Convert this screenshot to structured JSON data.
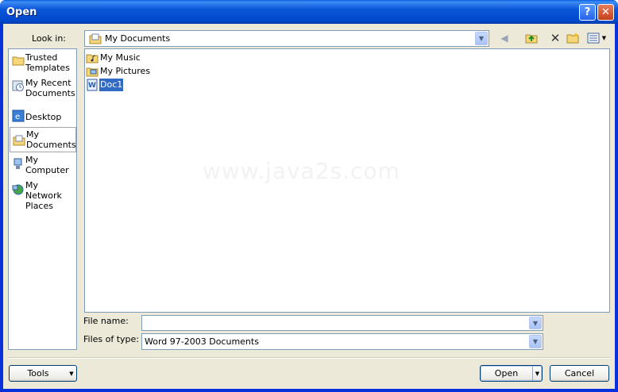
{
  "window": {
    "title": "Open",
    "help_label": "?",
    "close_label": "✕"
  },
  "look_in": {
    "label": "Look in:",
    "value": "My Documents",
    "toolbar": [
      "back-icon",
      "up-folder-icon",
      "delete-icon",
      "new-folder-icon",
      "views-icon"
    ]
  },
  "places": [
    {
      "label": "Trusted Templates",
      "icon": "folder-icon"
    },
    {
      "label": "My Recent Documents",
      "icon": "recent-documents-icon"
    },
    {
      "label": "Desktop",
      "icon": "desktop-icon"
    },
    {
      "label": "My Documents",
      "icon": "my-documents-icon",
      "selected": true
    },
    {
      "label": "My Computer",
      "icon": "my-computer-icon"
    },
    {
      "label": "My Network Places",
      "icon": "network-places-icon"
    }
  ],
  "files": [
    {
      "name": "My Music",
      "icon": "music-folder-icon"
    },
    {
      "name": "My Pictures",
      "icon": "pictures-folder-icon"
    },
    {
      "name": "Doc1",
      "icon": "word-document-icon",
      "selected": true
    }
  ],
  "watermark": "www.java2s.com",
  "file_name": {
    "label": "File name:",
    "value": ""
  },
  "files_of_type": {
    "label": "Files of type:",
    "value": "Word 97-2003 Documents"
  },
  "buttons": {
    "tools": "Tools",
    "open": "Open",
    "cancel": "Cancel"
  },
  "colors": {
    "title_bar": "#0a55d8",
    "selection": "#316ac5",
    "face": "#ece9d8"
  }
}
